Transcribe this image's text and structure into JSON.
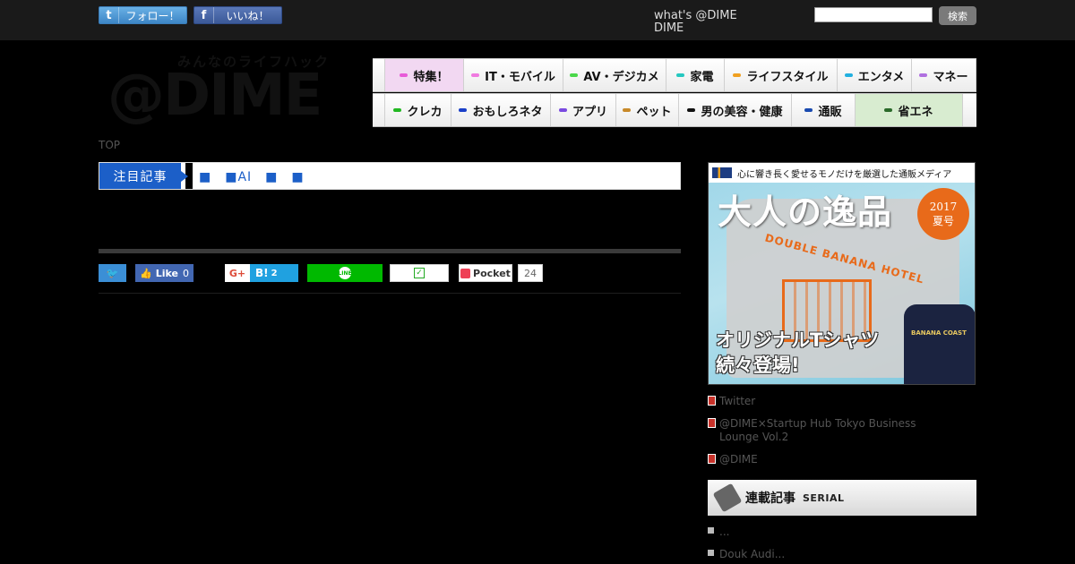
{
  "topbar": {
    "twitter_follow": "フォロー！",
    "facebook_like": "いいね！",
    "whats_line1": "what's @DIME",
    "whats_line2": "DIME",
    "search_placeholder": "",
    "search_button": "検索"
  },
  "logo": {
    "tagline": "みんなのライフハック",
    "mark": "@DIME"
  },
  "nav": {
    "row1": [
      {
        "label": "特集！",
        "color": "#e85ad8",
        "highlight": "#f2d8f2"
      },
      {
        "label": "IT・モバイル",
        "color": "#f07ae0"
      },
      {
        "label": "AV・デジカメ",
        "color": "#4ad84a"
      },
      {
        "label": "家電",
        "color": "#26c8c0"
      },
      {
        "label": "ライフスタイル",
        "color": "#f0a020"
      },
      {
        "label": "エンタメ",
        "color": "#22b0e0"
      },
      {
        "label": "マネー",
        "color": "#b070e0"
      }
    ],
    "row2": [
      {
        "label": "クレカ",
        "color": "#22b822"
      },
      {
        "label": "おもしろネタ",
        "color": "#1a3fc8"
      },
      {
        "label": "アプリ",
        "color": "#7a4ae0"
      },
      {
        "label": "ペット",
        "color": "#c88a2a"
      },
      {
        "label": "男の美容・健康",
        "color": "#111111"
      },
      {
        "label": "通販",
        "color": "#1a4ab0"
      },
      {
        "label": "省エネ",
        "color": "#2a6a2a",
        "highlight": "#d8ecd0"
      }
    ]
  },
  "breadcrumb": "TOP",
  "attention": {
    "label": "注目記事",
    "text": "■　■AI　■　■"
  },
  "share": {
    "twitter": "🐦",
    "fb_like": "Like",
    "fb_count": "0",
    "gplus": "G+",
    "hatena": "B!",
    "hatena_count": "2",
    "line": "LINE",
    "line_check": "✓",
    "pocket": "Pocket",
    "pocket_count": "24"
  },
  "ad": {
    "topline": "心に響き長く愛せるモノだけを厳選した通販メディア",
    "title": "大人の逸品",
    "badge_year": "2017",
    "badge_season": "夏号",
    "hotel": "DOUBLE BANANA HOTEL",
    "navy_text": "BANANA COAST",
    "bottom_line1": "オリジナルTシャツ",
    "bottom_line2": "続々登場!"
  },
  "side_links": [
    "Twitter",
    "@DIME×Startup Hub Tokyo Business Lounge Vol.2",
    "@DIME"
  ],
  "serial": {
    "title_jp": "連載記事",
    "title_en": "SERIAL",
    "items": [
      "...",
      "Douk Audi..."
    ]
  }
}
